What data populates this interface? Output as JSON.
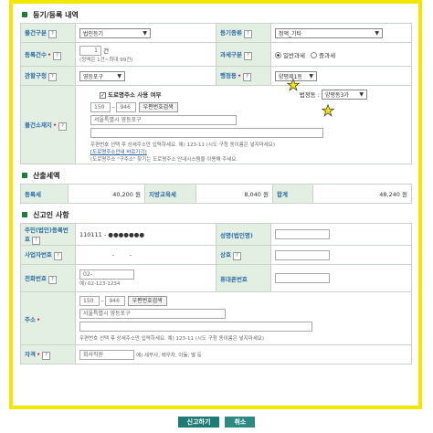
{
  "sections": {
    "registration": "등기/등록 내역",
    "tax": "산출세액",
    "reporter": "신고인 사항"
  },
  "reg": {
    "category_label": "물건구분",
    "category_value": "법인등기",
    "reg_type_label": "등기종류",
    "reg_type_value": "정액_기타",
    "count_label": "등록건수",
    "count_value": "1",
    "count_unit": "건",
    "count_note": "(정액은 1건~최대 99건)",
    "tax_type_label": "과세구분",
    "tax_type_options": [
      "일반과세",
      "중과세"
    ],
    "office_label": "관할구청",
    "office_value": "영등포구",
    "dong_label": "행정동",
    "dong_value": "양평제1동",
    "road_check_label": "도로명주소 사용 여부",
    "legal_dong_label": "법정동 :",
    "legal_dong_value": "양평동3가",
    "location_label": "물건소재지",
    "zip1": "150",
    "zip2": "946",
    "zip_button": "우편번호검색",
    "addr1": "서울특별시 영등포구",
    "addr_hint": "우편번호 선택 후 상세주소만 입력하세요. 예) 123-11 (시도 구청 동이름은 넣지마세요)",
    "road_link": "[도로명주소안내 바로가기]",
    "road_hint": "(도로명주소 \"구주소\" 찾기는 도로명주소 안내시스템을 이용해 주세요."
  },
  "tax": {
    "reg_tax_label": "등록세",
    "reg_tax_value": "40,200",
    "edu_tax_label": "지방교육세",
    "edu_tax_value": "8,040",
    "total_label": "합계",
    "total_value": "48,240",
    "unit": "원"
  },
  "reporter": {
    "id_label": "주민(법인)등록번호",
    "id_value": "110111 - ●●●●●●●",
    "name_label": "성명(법인명)",
    "bizno_label": "사업자번호",
    "bizno_sep": "-",
    "company_label": "상호",
    "phone_label": "전화번호",
    "phone_prefix": "02-",
    "phone_example": "예) 02-123-1234",
    "mobile_label": "휴대폰번호",
    "addr_label": "주소",
    "zip1": "150",
    "zip2": "946",
    "zip_button": "우편번호검색",
    "addr1": "서울특별시 영등포구",
    "addr_hint": "우편번호 선택 후 상세주소만 입력하세요. 예) 123-11 (시도 구청 동이름은 넣지마세요)",
    "qual_label": "자격",
    "qual_value": "회사직원",
    "qual_example": "예) 세무사, 배우자, 아들, 딸 등"
  },
  "buttons": {
    "submit": "신고하기",
    "cancel": "취소"
  },
  "help_glyph": "?",
  "colors": {
    "highlight": "#f2e600",
    "label_bg": "#e4efe4",
    "accent": "#1f7d3f",
    "button": "#1d7b74"
  }
}
